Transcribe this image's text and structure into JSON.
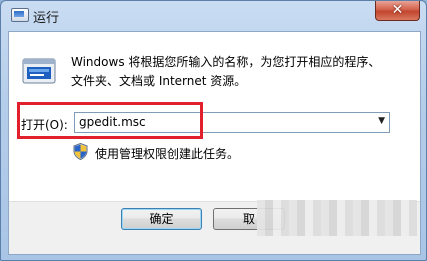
{
  "window": {
    "title": "运行",
    "close_label": "✕"
  },
  "description": {
    "line1": "Windows 将根据您所输入的名称，为您打开相应的程序、",
    "line2": "文件夹、文档或 Internet 资源。"
  },
  "open_field": {
    "label": "打开(O):",
    "value": "gpedit.msc",
    "dropdown_icon": "chevron-down-icon"
  },
  "admin_note": "使用管理权限创建此任务。",
  "buttons": {
    "ok": "确定",
    "cancel": "取"
  },
  "icons": {
    "title": "run-app-icon",
    "main": "run-program-icon",
    "shield": "uac-shield-icon"
  },
  "colors": {
    "highlight": "#e0202b",
    "close_button": "#c2452e",
    "title_bar": "#b4cde9"
  }
}
